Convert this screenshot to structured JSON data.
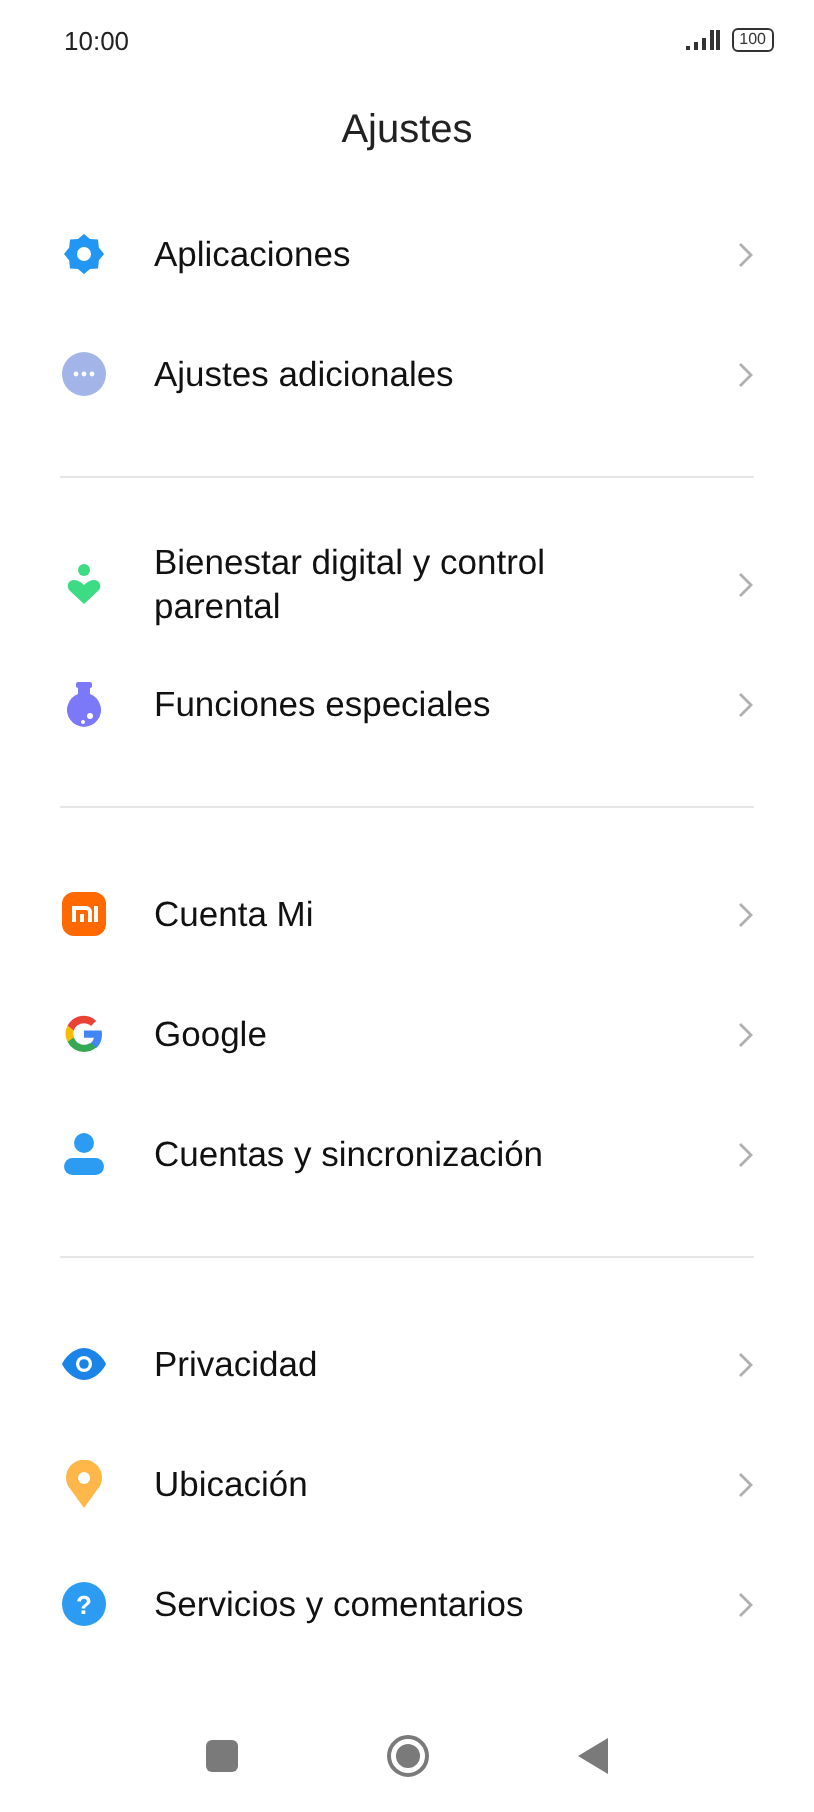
{
  "status_bar": {
    "time": "10:00",
    "battery": "100"
  },
  "title": "Ajustes",
  "groups": [
    {
      "items": [
        {
          "kind": "apps",
          "label": "Aplicaciones"
        },
        {
          "kind": "more",
          "label": "Ajustes adicionales"
        }
      ]
    },
    {
      "items": [
        {
          "kind": "wellbeing",
          "label": "Bienestar digital y control parental"
        },
        {
          "kind": "special",
          "label": "Funciones especiales"
        }
      ]
    },
    {
      "items": [
        {
          "kind": "mi",
          "label": "Cuenta Mi"
        },
        {
          "kind": "google",
          "label": "Google"
        },
        {
          "kind": "account",
          "label": "Cuentas y sincronización"
        }
      ]
    },
    {
      "items": [
        {
          "kind": "privacy",
          "label": "Privacidad"
        },
        {
          "kind": "location",
          "label": "Ubicación"
        },
        {
          "kind": "help",
          "label": "Servicios y comentarios",
          "glyph": "?"
        }
      ]
    }
  ]
}
